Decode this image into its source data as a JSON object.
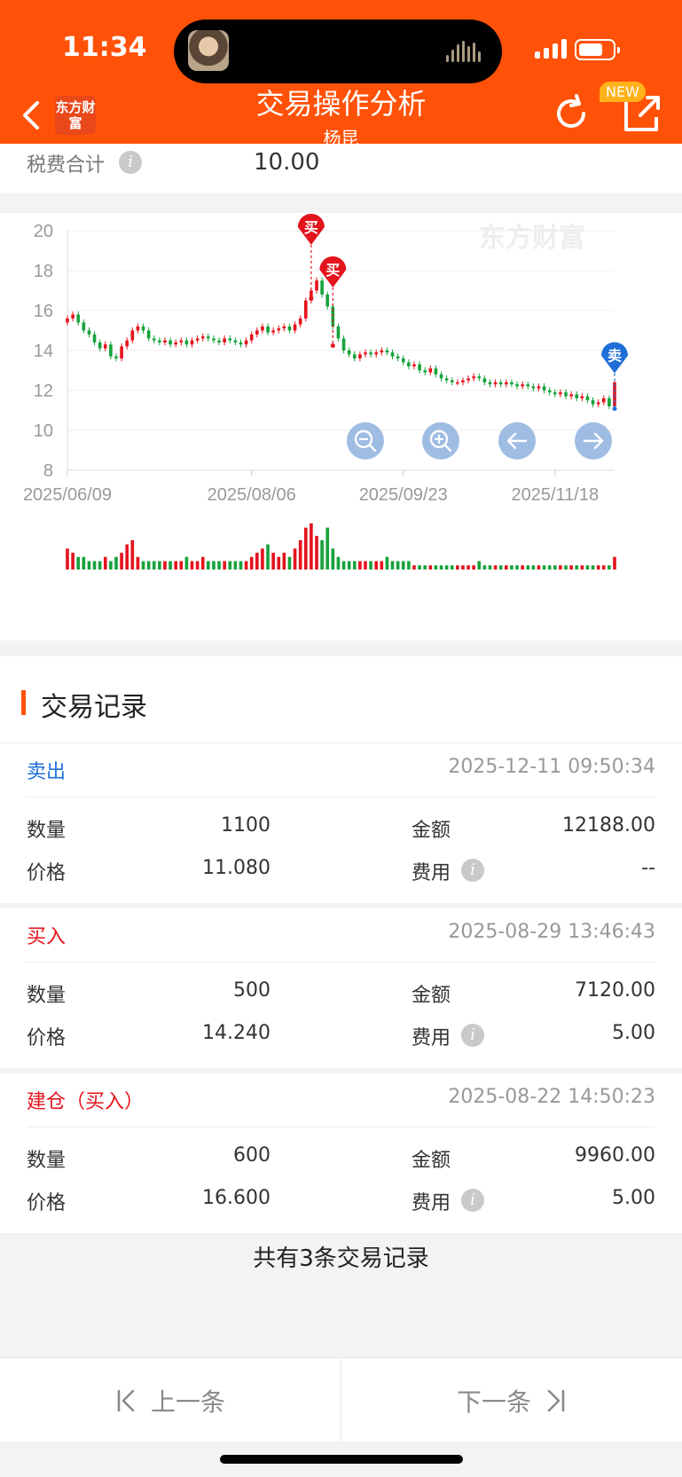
{
  "status_bar": {
    "time": "11:34"
  },
  "header": {
    "title": "交易操作分析",
    "subtitle": "杨昆",
    "logo_text": "东方财富",
    "new_badge": "NEW"
  },
  "fee": {
    "label": "税费合计",
    "value": "10.00"
  },
  "chart_data": {
    "type": "candlestick",
    "watermark": "东方财富",
    "y_ticks": [
      20,
      18,
      16,
      14,
      12,
      10,
      8
    ],
    "ylim": [
      8,
      20
    ],
    "x_tick_labels": [
      "2025/06/09",
      "2025/08/06",
      "2025/09/23",
      "2025/11/18"
    ],
    "close_path": [
      15.6,
      15.8,
      15.4,
      15.0,
      14.8,
      14.4,
      14.1,
      14.3,
      13.7,
      13.6,
      14.2,
      14.5,
      15.0,
      15.2,
      15.0,
      14.6,
      14.5,
      14.4,
      14.5,
      14.3,
      14.4,
      14.5,
      14.3,
      14.5,
      14.6,
      14.7,
      14.6,
      14.5,
      14.4,
      14.6,
      14.5,
      14.4,
      14.3,
      14.5,
      14.8,
      15.0,
      15.2,
      14.9,
      15.0,
      15.1,
      15.2,
      15.0,
      15.3,
      15.6,
      16.5,
      17.0,
      17.5,
      16.8,
      16.2,
      15.2,
      14.6,
      14.0,
      13.8,
      13.6,
      13.8,
      13.9,
      13.8,
      13.9,
      14.0,
      13.9,
      13.7,
      13.6,
      13.4,
      13.2,
      13.3,
      13.0,
      12.9,
      13.1,
      12.8,
      12.6,
      12.5,
      12.4,
      12.4,
      12.5,
      12.6,
      12.7,
      12.6,
      12.4,
      12.3,
      12.4,
      12.3,
      12.4,
      12.3,
      12.2,
      12.3,
      12.2,
      12.1,
      12.2,
      12.0,
      11.9,
      11.8,
      11.9,
      11.7,
      11.8,
      11.6,
      11.7,
      11.5,
      11.3,
      11.4,
      11.6,
      11.2,
      12.4
    ],
    "volume_path": [
      5,
      4,
      3,
      3,
      2,
      2,
      2,
      3,
      2,
      3,
      4,
      6,
      7,
      3,
      2,
      2,
      2,
      2,
      2,
      2,
      2,
      2,
      3,
      2,
      2,
      3,
      2,
      2,
      2,
      2,
      2,
      2,
      2,
      2,
      3,
      4,
      5,
      6,
      4,
      3,
      4,
      3,
      5,
      7,
      10,
      11,
      8,
      7,
      10,
      5,
      3,
      2,
      2,
      2,
      2,
      2,
      2,
      2,
      2,
      3,
      2,
      2,
      2,
      2,
      1,
      1,
      1,
      1,
      1,
      1,
      1,
      1,
      1,
      1,
      1,
      1,
      2,
      1,
      1,
      1,
      1,
      1,
      1,
      1,
      1,
      1,
      1,
      1,
      1,
      1,
      1,
      1,
      1,
      1,
      1,
      1,
      1,
      1,
      1,
      1,
      1,
      3
    ],
    "markers": [
      {
        "type": "buy",
        "label": "买",
        "index": 45,
        "price": 16.6
      },
      {
        "type": "buy",
        "label": "买",
        "index": 49,
        "price": 14.24
      },
      {
        "type": "sell",
        "label": "卖",
        "index": 101,
        "price": 11.08
      }
    ],
    "buy_color": "#e4141d",
    "sell_color": "#1f6fd6",
    "up_color": "#e4141d",
    "down_color": "#16a33c"
  },
  "chart_controls": [
    "zoom-out",
    "zoom-in",
    "left",
    "right"
  ],
  "records_title": "交易记录",
  "labels": {
    "qty": "数量",
    "amount": "金额",
    "price": "价格",
    "fee": "费用"
  },
  "records": [
    {
      "type": "卖出",
      "kind": "sell",
      "time": "2025-12-11 09:50:34",
      "qty": "1100",
      "amount": "12188.00",
      "price": "11.080",
      "fee": "--"
    },
    {
      "type": "买入",
      "kind": "buy",
      "time": "2025-08-29 13:46:43",
      "qty": "500",
      "amount": "7120.00",
      "price": "14.240",
      "fee": "5.00"
    },
    {
      "type": "建仓（买入）",
      "kind": "buy",
      "time": "2025-08-22 14:50:23",
      "qty": "600",
      "amount": "9960.00",
      "price": "16.600",
      "fee": "5.00"
    }
  ],
  "summary": "共有3条交易记录",
  "footer": {
    "prev": "上一条",
    "next": "下一条"
  }
}
